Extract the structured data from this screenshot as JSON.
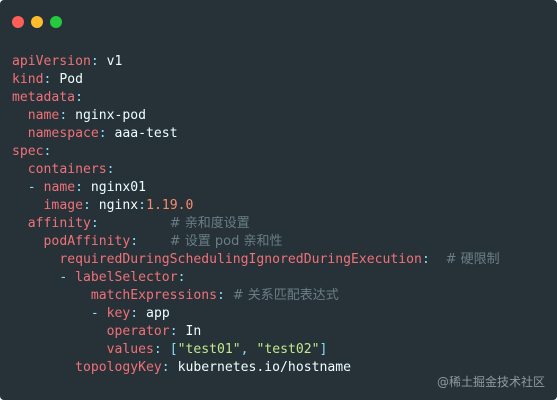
{
  "window": {
    "traffic_lights": [
      {
        "name": "close-dot",
        "color": "#ff5f56"
      },
      {
        "name": "minimize-dot",
        "color": "#ffbd2e"
      },
      {
        "name": "zoom-dot",
        "color": "#27c93f"
      }
    ]
  },
  "colors": {
    "background": "#263238",
    "key": "#f07178",
    "punct": "#89ddff",
    "value": "#eeffff",
    "number": "#f78c6c",
    "string": "#c3e88d",
    "comment": "#6b7d86"
  },
  "code_lines": [
    [
      [
        "key",
        "apiVersion"
      ],
      [
        "punct",
        ":"
      ],
      [
        "val",
        " v1"
      ]
    ],
    [
      [
        "key",
        "kind"
      ],
      [
        "punct",
        ":"
      ],
      [
        "val",
        " Pod"
      ]
    ],
    [
      [
        "key",
        "metadata"
      ],
      [
        "punct",
        ":"
      ]
    ],
    [
      [
        "ind",
        "  "
      ],
      [
        "key",
        "name"
      ],
      [
        "punct",
        ":"
      ],
      [
        "val",
        " nginx-pod"
      ]
    ],
    [
      [
        "ind",
        "  "
      ],
      [
        "key",
        "namespace"
      ],
      [
        "punct",
        ":"
      ],
      [
        "val",
        " aaa-test"
      ]
    ],
    [
      [
        "key",
        "spec"
      ],
      [
        "punct",
        ":"
      ]
    ],
    [
      [
        "ind",
        "  "
      ],
      [
        "key",
        "containers"
      ],
      [
        "punct",
        ":"
      ]
    ],
    [
      [
        "ind",
        "  "
      ],
      [
        "punct",
        "- "
      ],
      [
        "key",
        "name"
      ],
      [
        "punct",
        ":"
      ],
      [
        "val",
        " nginx01"
      ]
    ],
    [
      [
        "ind",
        "    "
      ],
      [
        "key",
        "image"
      ],
      [
        "punct",
        ":"
      ],
      [
        "val",
        " nginx"
      ],
      [
        "punct",
        ":"
      ],
      [
        "num",
        "1.19.0"
      ]
    ],
    [
      [
        "ind",
        "  "
      ],
      [
        "key",
        "affinity"
      ],
      [
        "punct",
        ":"
      ],
      [
        "ind",
        "         "
      ],
      [
        "comment",
        "# 亲和度设置"
      ]
    ],
    [
      [
        "ind",
        "    "
      ],
      [
        "key",
        "podAffinity"
      ],
      [
        "punct",
        ":"
      ],
      [
        "ind",
        "    "
      ],
      [
        "comment",
        "# 设置 pod 亲和性"
      ]
    ],
    [
      [
        "ind",
        "      "
      ],
      [
        "key",
        "requiredDuringSchedulingIgnoredDuringExecution"
      ],
      [
        "punct",
        ":"
      ],
      [
        "ind",
        "  "
      ],
      [
        "comment",
        "# 硬限制"
      ]
    ],
    [
      [
        "ind",
        "      "
      ],
      [
        "punct",
        "- "
      ],
      [
        "key",
        "labelSelector"
      ],
      [
        "punct",
        ":"
      ]
    ],
    [
      [
        "ind",
        "          "
      ],
      [
        "key",
        "matchExpressions"
      ],
      [
        "punct",
        ":"
      ],
      [
        "ind",
        " "
      ],
      [
        "comment",
        "# 关系匹配表达式"
      ]
    ],
    [
      [
        "ind",
        "          "
      ],
      [
        "punct",
        "- "
      ],
      [
        "key",
        "key"
      ],
      [
        "punct",
        ":"
      ],
      [
        "val",
        " app"
      ]
    ],
    [
      [
        "ind",
        "            "
      ],
      [
        "key",
        "operator"
      ],
      [
        "punct",
        ":"
      ],
      [
        "val",
        " In"
      ]
    ],
    [
      [
        "ind",
        "            "
      ],
      [
        "key",
        "values"
      ],
      [
        "punct",
        ":"
      ],
      [
        "val",
        " "
      ],
      [
        "punct",
        "["
      ],
      [
        "str",
        "\"test01\""
      ],
      [
        "punct",
        ", "
      ],
      [
        "str",
        "\"test02\""
      ],
      [
        "punct",
        "]"
      ]
    ],
    [
      [
        "ind",
        "        "
      ],
      [
        "key",
        "topologyKey"
      ],
      [
        "punct",
        ":"
      ],
      [
        "val",
        " kubernetes.io/hostname"
      ]
    ]
  ],
  "watermark": "@稀土掘金技术社区"
}
